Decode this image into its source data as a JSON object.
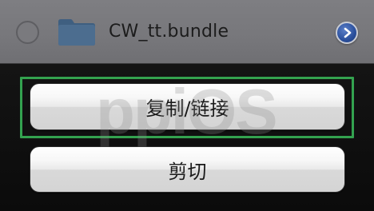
{
  "file_row": {
    "name": "CW_tt.bundle",
    "icon": "folder-icon",
    "accessory_icon": "chevron-right-icon"
  },
  "action_sheet": {
    "buttons": [
      {
        "label": "复制/链接",
        "highlighted": true
      },
      {
        "label": "剪切",
        "highlighted": false
      }
    ]
  },
  "watermark": "ppiOS",
  "colors": {
    "highlight_border": "#33a24f",
    "accessory_blue": "#2a4f9c",
    "folder_blue": "#4c6d8f"
  }
}
